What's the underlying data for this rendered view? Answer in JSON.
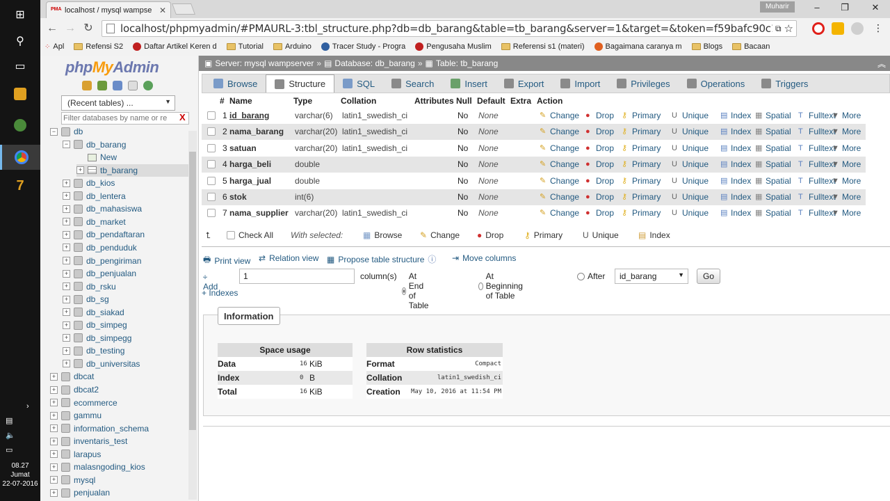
{
  "taskbar": {
    "time": "08.27",
    "day": "Jumat",
    "date": "22-07-2016"
  },
  "browser": {
    "tab_title": "localhost / mysql wampse",
    "favicon_text": "PMA",
    "user_badge": "Muharir",
    "url": "localhost/phpmyadmin/#PMAURL-3:tbl_structure.php?db=db_barang&table=tb_barang&server=1&target=&token=f59bafc90c1c103119edf06",
    "bookmarks": [
      {
        "label": "Apl",
        "icon": "apps-icon"
      },
      {
        "label": "Refensi S2",
        "icon": "folder-icon"
      },
      {
        "label": "Daftar Artikel Keren d",
        "icon": "site-icon"
      },
      {
        "label": "Tutorial",
        "icon": "folder-icon"
      },
      {
        "label": "Arduino",
        "icon": "folder-icon"
      },
      {
        "label": "Tracer Study - Progra",
        "icon": "site-icon"
      },
      {
        "label": "Pengusaha Muslim",
        "icon": "site-icon"
      },
      {
        "label": "Referensi s1 (materi)",
        "icon": "folder-icon"
      },
      {
        "label": "Bagaimana caranya m",
        "icon": "site-icon"
      },
      {
        "label": "Blogs",
        "icon": "folder-icon"
      },
      {
        "label": "Bacaan",
        "icon": "folder-icon"
      }
    ]
  },
  "nav": {
    "logo_php": "php",
    "logo_my": "My",
    "logo_admin": "Admin",
    "recent_tables": "(Recent tables) ...",
    "filter_placeholder": "Filter databases by name or re",
    "filter_clear": "X",
    "tree": [
      {
        "label": "db",
        "level": 0,
        "expander": "−",
        "kind": "db"
      },
      {
        "label": "db_barang",
        "level": 1,
        "expander": "−",
        "kind": "db"
      },
      {
        "label": "New",
        "level": 2,
        "expander": "",
        "kind": "new"
      },
      {
        "label": "tb_barang",
        "level": 2,
        "expander": "+",
        "kind": "table",
        "selected": true
      },
      {
        "label": "db_kios",
        "level": 1,
        "expander": "+",
        "kind": "db"
      },
      {
        "label": "db_lentera",
        "level": 1,
        "expander": "+",
        "kind": "db"
      },
      {
        "label": "db_mahasiswa",
        "level": 1,
        "expander": "+",
        "kind": "db"
      },
      {
        "label": "db_market",
        "level": 1,
        "expander": "+",
        "kind": "db"
      },
      {
        "label": "db_pendaftaran",
        "level": 1,
        "expander": "+",
        "kind": "db"
      },
      {
        "label": "db_penduduk",
        "level": 1,
        "expander": "+",
        "kind": "db"
      },
      {
        "label": "db_pengiriman",
        "level": 1,
        "expander": "+",
        "kind": "db"
      },
      {
        "label": "db_penjualan",
        "level": 1,
        "expander": "+",
        "kind": "db"
      },
      {
        "label": "db_rsku",
        "level": 1,
        "expander": "+",
        "kind": "db"
      },
      {
        "label": "db_sg",
        "level": 1,
        "expander": "+",
        "kind": "db"
      },
      {
        "label": "db_siakad",
        "level": 1,
        "expander": "+",
        "kind": "db"
      },
      {
        "label": "db_simpeg",
        "level": 1,
        "expander": "+",
        "kind": "db"
      },
      {
        "label": "db_simpegg",
        "level": 1,
        "expander": "+",
        "kind": "db"
      },
      {
        "label": "db_testing",
        "level": 1,
        "expander": "+",
        "kind": "db"
      },
      {
        "label": "db_universitas",
        "level": 1,
        "expander": "+",
        "kind": "db"
      },
      {
        "label": "dbcat",
        "level": 0,
        "expander": "+",
        "kind": "db"
      },
      {
        "label": "dbcat2",
        "level": 0,
        "expander": "+",
        "kind": "db"
      },
      {
        "label": "ecommerce",
        "level": 0,
        "expander": "+",
        "kind": "db"
      },
      {
        "label": "gammu",
        "level": 0,
        "expander": "+",
        "kind": "db"
      },
      {
        "label": "information_schema",
        "level": 0,
        "expander": "+",
        "kind": "db"
      },
      {
        "label": "inventaris_test",
        "level": 0,
        "expander": "+",
        "kind": "db"
      },
      {
        "label": "larapus",
        "level": 0,
        "expander": "+",
        "kind": "db"
      },
      {
        "label": "malasngoding_kios",
        "level": 0,
        "expander": "+",
        "kind": "db"
      },
      {
        "label": "mysql",
        "level": 0,
        "expander": "+",
        "kind": "db"
      },
      {
        "label": "penjualan",
        "level": 0,
        "expander": "+",
        "kind": "db"
      }
    ]
  },
  "breadcrumb": {
    "server": "Server: mysql wampserver",
    "database": "Database: db_barang",
    "table": "Table: tb_barang",
    "sep": "»"
  },
  "tabs": [
    {
      "label": "Browse",
      "active": false
    },
    {
      "label": "Structure",
      "active": true
    },
    {
      "label": "SQL",
      "active": false
    },
    {
      "label": "Search",
      "active": false
    },
    {
      "label": "Insert",
      "active": false
    },
    {
      "label": "Export",
      "active": false
    },
    {
      "label": "Import",
      "active": false
    },
    {
      "label": "Privileges",
      "active": false
    },
    {
      "label": "Operations",
      "active": false
    },
    {
      "label": "Triggers",
      "active": false
    }
  ],
  "structure": {
    "headers": [
      "#",
      "Name",
      "Type",
      "Collation",
      "Attributes",
      "Null",
      "Default",
      "Extra",
      "Action"
    ],
    "actions": [
      "Change",
      "Drop",
      "Primary",
      "Unique",
      "Index",
      "Spatial",
      "Fulltext",
      "More"
    ],
    "rows": [
      {
        "num": "1",
        "name": "id_barang",
        "pk": true,
        "type": "varchar(6)",
        "collation": "latin1_swedish_ci",
        "null": "No",
        "default": "None"
      },
      {
        "num": "2",
        "name": "nama_barang",
        "pk": false,
        "type": "varchar(20)",
        "collation": "latin1_swedish_ci",
        "null": "No",
        "default": "None"
      },
      {
        "num": "3",
        "name": "satuan",
        "pk": false,
        "type": "varchar(20)",
        "collation": "latin1_swedish_ci",
        "null": "No",
        "default": "None"
      },
      {
        "num": "4",
        "name": "harga_beli",
        "pk": false,
        "type": "double",
        "collation": "",
        "null": "No",
        "default": "None"
      },
      {
        "num": "5",
        "name": "harga_jual",
        "pk": false,
        "type": "double",
        "collation": "",
        "null": "No",
        "default": "None"
      },
      {
        "num": "6",
        "name": "stok",
        "pk": false,
        "type": "int(6)",
        "collation": "",
        "null": "No",
        "default": "None"
      },
      {
        "num": "7",
        "name": "nama_supplier",
        "pk": false,
        "type": "varchar(20)",
        "collation": "latin1_swedish_ci",
        "null": "No",
        "default": "None"
      }
    ]
  },
  "with_selected": {
    "check_all": "Check All",
    "label": "With selected:",
    "actions": [
      "Browse",
      "Change",
      "Drop",
      "Primary",
      "Unique",
      "Index"
    ]
  },
  "links": {
    "print_view": "Print view",
    "relation_view": "Relation view",
    "propose": "Propose table structure",
    "move_columns": "Move columns"
  },
  "add": {
    "label": "Add",
    "count": "1",
    "columns_label": "column(s)",
    "at_end": "At End of Table",
    "at_beginning": "At Beginning of Table",
    "after": "After",
    "after_value": "id_barang",
    "go": "Go"
  },
  "indexes_link": "+ Indexes",
  "information": {
    "legend": "Information",
    "space_usage": {
      "title": "Space usage",
      "rows": [
        {
          "label": "Data",
          "value": "16",
          "unit": "KiB"
        },
        {
          "label": "Index",
          "value": "0",
          "unit": "B"
        },
        {
          "label": "Total",
          "value": "16",
          "unit": "KiB"
        }
      ]
    },
    "row_statistics": {
      "title": "Row statistics",
      "rows": [
        {
          "label": "Format",
          "value": "Compact"
        },
        {
          "label": "Collation",
          "value": "latin1_swedish_ci"
        },
        {
          "label": "Creation",
          "value": "May 10, 2016 at 11:54 PM"
        }
      ]
    }
  }
}
